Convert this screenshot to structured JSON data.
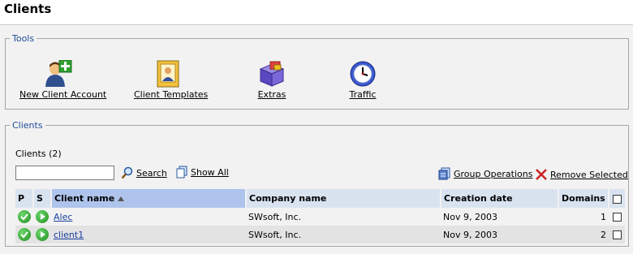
{
  "page": {
    "title": "Clients"
  },
  "tools": {
    "legend": "Tools",
    "items": [
      {
        "label": "New Client Account",
        "icon": "add-user-icon"
      },
      {
        "label": "Client Templates",
        "icon": "template-icon"
      },
      {
        "label": "Extras",
        "icon": "box-icon"
      },
      {
        "label": "Traffic",
        "icon": "clock-icon"
      }
    ]
  },
  "clients": {
    "legend": "Clients",
    "count_label": "Clients (2)",
    "search": {
      "value": "",
      "button_label": "Search",
      "show_all_label": "Show All"
    },
    "group_operations_label": "Group Operations",
    "remove_selected_label": "Remove Selected",
    "columns": {
      "p": "P",
      "s": "S",
      "client_name": "Client name",
      "company_name": "Company name",
      "creation_date": "Creation date",
      "domains": "Domains"
    },
    "sort": {
      "column": "client_name",
      "direction": "ascending"
    },
    "rows": [
      {
        "client_name": "Alec",
        "company_name": "SWsoft, Inc.",
        "creation_date": "Nov 9, 2003",
        "domains": "1"
      },
      {
        "client_name": "client1",
        "company_name": "SWsoft, Inc.",
        "creation_date": "Nov 9, 2003",
        "domains": "2"
      }
    ]
  },
  "colors": {
    "header_bg": "#d9e3f0",
    "sorted_header_bg": "#aec4ec",
    "legend": "#1d4b99",
    "link": "#1a3fa0",
    "status_ok": "#1f8f1f",
    "remove": "#cc2222"
  }
}
